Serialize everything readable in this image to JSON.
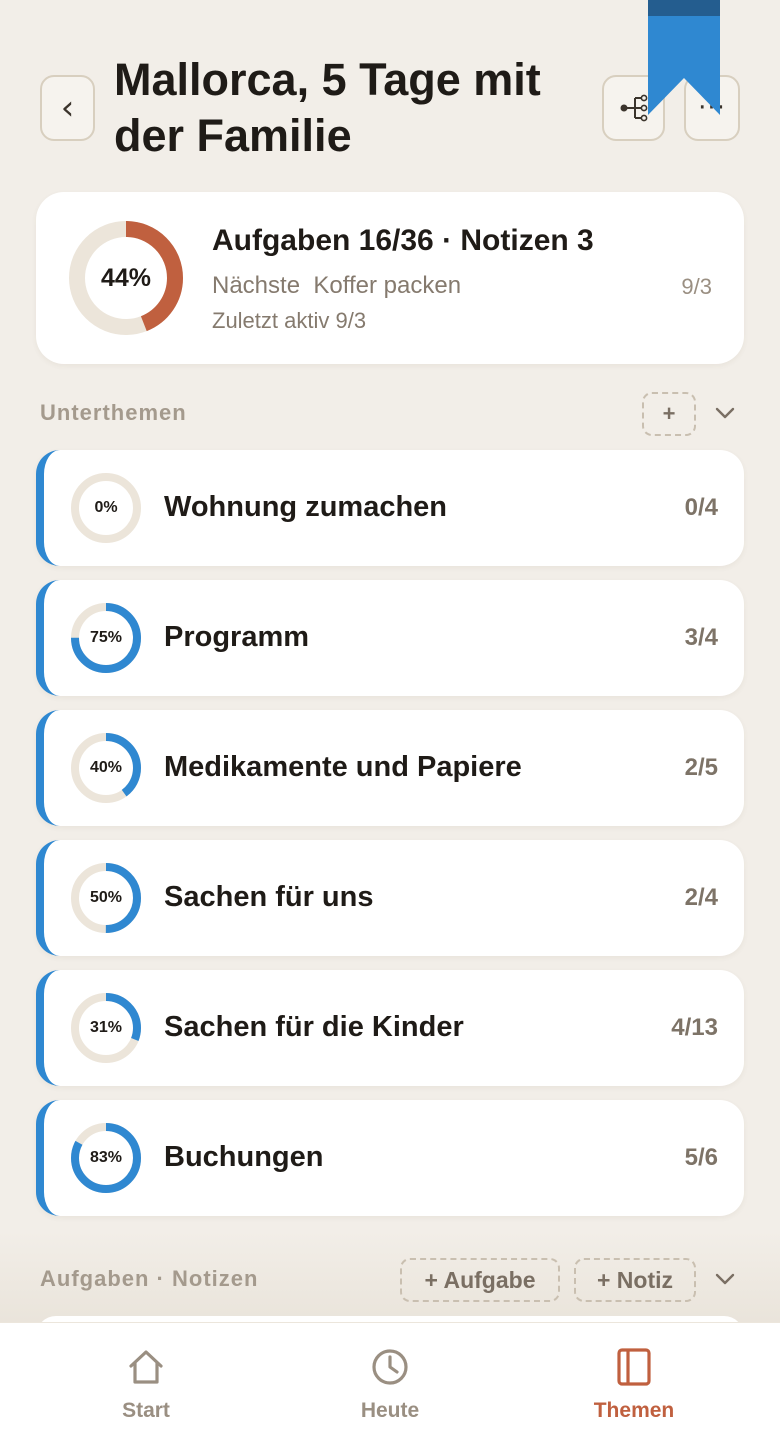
{
  "header": {
    "back_label": "‹",
    "title": "Mallorca, 5 Tage mit der Familie",
    "more_label": "···"
  },
  "summary": {
    "progress": 0.44,
    "progress_label": "44%",
    "title": "Aufgaben 16/36 · Notizen 3",
    "next_label": "Nächste",
    "next_task": "Koffer packen",
    "next_date": "9/3",
    "last_active": "Zuletzt aktiv 9/3"
  },
  "subtopics_section": {
    "label": "Unterthemen",
    "add_label": "+"
  },
  "subtopics": [
    {
      "title": "Wohnung zumachen",
      "progress": 0.0,
      "progress_label": "0%",
      "count": "0/4"
    },
    {
      "title": "Programm",
      "progress": 0.75,
      "progress_label": "75%",
      "count": "3/4"
    },
    {
      "title": "Medikamente und Papiere",
      "progress": 0.4,
      "progress_label": "40%",
      "count": "2/5"
    },
    {
      "title": "Sachen für uns",
      "progress": 0.5,
      "progress_label": "50%",
      "count": "2/4"
    },
    {
      "title": "Sachen für die Kinder",
      "progress": 0.31,
      "progress_label": "31%",
      "count": "4/13"
    },
    {
      "title": "Buchungen",
      "progress": 0.83,
      "progress_label": "83%",
      "count": "5/6"
    }
  ],
  "tasks_section": {
    "label": "Aufgaben · Notizen",
    "add_task_label": "+ Aufgabe",
    "add_note_label": "+ Notiz"
  },
  "nav": {
    "items": [
      {
        "label": "Start",
        "icon": "home-icon",
        "active": false
      },
      {
        "label": "Heute",
        "icon": "clock-icon",
        "active": false
      },
      {
        "label": "Themen",
        "icon": "book-icon",
        "active": true
      }
    ]
  },
  "colors": {
    "background": "#f2eee8",
    "accent_blue": "#2f88d1",
    "accent_rust": "#c0603f",
    "ring_track": "#ece5da",
    "muted_text": "#857a6e"
  }
}
